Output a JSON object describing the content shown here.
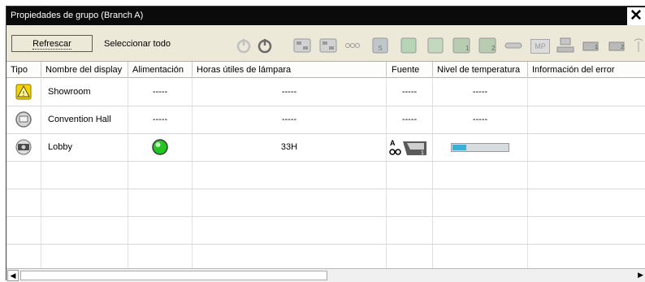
{
  "window": {
    "title": "Propiedades de grupo (Branch A)",
    "close_glyph": "✕"
  },
  "toolbar": {
    "refresh_label": "Refrescar",
    "select_all_label": "Seleccionar todo",
    "icons": [
      "power-on-icon",
      "power-off-icon",
      "input-1-icon",
      "input-2-icon",
      "input-3-icon",
      "source-s-icon",
      "source-d-icon",
      "source-p-icon",
      "panel-1-icon",
      "panel-2-icon",
      "av-mute-icon",
      "mp-icon",
      "network-icon",
      "projector-1-icon",
      "projector-2-icon",
      "wireless-icon"
    ],
    "mp_label": "MP"
  },
  "grid": {
    "columns": [
      "Tipo",
      "Nombre del display",
      "Alimentación",
      "Horas útiles de lámpara",
      "Fuente",
      "Nivel de temperatura",
      "Información del error"
    ],
    "rows": [
      {
        "type_icon": "warning-projector-icon",
        "name": "Showroom",
        "power": "-----",
        "lamp_hours": "-----",
        "source": "-----",
        "temperature": "-----",
        "error": ""
      },
      {
        "type_icon": "projector-grey-icon",
        "name": "Convention Hall",
        "power": "-----",
        "lamp_hours": "-----",
        "source": "-----",
        "temperature": "-----",
        "error": ""
      },
      {
        "type_icon": "projector-dark-icon",
        "name": "Lobby",
        "power_icon": "power-green-led-icon",
        "lamp_hours": "33H",
        "source_icon": "source-a-computer-1-icon",
        "temperature_level": 0.25,
        "error": ""
      }
    ],
    "status_colors": {
      "power_on": "#22c522",
      "temperature": "#3ab0d8"
    }
  },
  "scrollbar": {
    "left_arrow": "◀",
    "right_arrow": "▶"
  }
}
